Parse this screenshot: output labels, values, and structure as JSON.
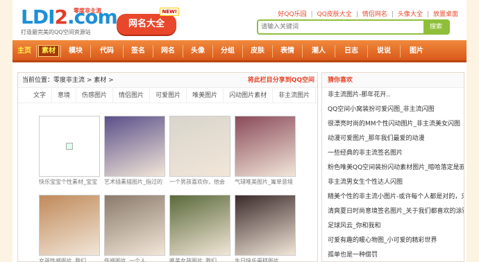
{
  "logo": {
    "text_a": "LDI",
    "text_b": "2",
    "text_c": ".com",
    "slogan": "零度非主流",
    "subtitle": "打造最完美的QQ空间资源站"
  },
  "badge": {
    "label": "网名大全",
    "new": "NEW!"
  },
  "toplinks": [
    "好QQ乐园",
    "QQ皮肤大全",
    "情侣网名",
    "头像大全",
    "放置桌面"
  ],
  "search": {
    "placeholder": "请输入关键词",
    "button": "搜索"
  },
  "nav": [
    "主页",
    "素材",
    "模块",
    "代码",
    "签名",
    "网名",
    "头像",
    "分组",
    "皮肤",
    "表情",
    "潮人",
    "日志",
    "说说",
    "图片"
  ],
  "breadcrumb": {
    "text": "当前位置：零度非主流 > 素材 >",
    "share": "将此栏目分享到QQ空间"
  },
  "tabs": [
    "文字",
    "意境",
    "伤感图片",
    "情侣图片",
    "可爱图片",
    "唯美图片",
    "闪动图片素材",
    "非主流图片"
  ],
  "thumbs": [
    {
      "caption": "快乐宝宝个性素材_宝宝",
      "tone": "#eeeeee"
    },
    {
      "caption": "艺术插素描图片_指过的",
      "tone": "#5a4f8a"
    },
    {
      "caption": "一个男孩喜欢你，他会",
      "tone": "#d8d5cc"
    },
    {
      "caption": "气球唯美图片_寓单意境",
      "tone": "#8a4a5a"
    },
    {
      "caption": "女孩性感图片_我们",
      "tone": "#c08a5a"
    },
    {
      "caption": "伤感图片_一个人",
      "tone": "#8a7a6a"
    },
    {
      "caption": "唯美女孩图片_我们",
      "tone": "#5a6a3a"
    },
    {
      "caption": "生日快乐蛋糕图片",
      "tone": "#3a2a2a"
    }
  ],
  "sidebar": {
    "title": "猜你喜欢",
    "items": [
      "非主流图片-那年花开..",
      "QQ空间小窝装扮可爱闪图_非主流闪图",
      "很漂亮时尚的MM个性闪动图片_非主流美女闪图",
      "动漫可爱图片_那年我们最爱的动漫",
      "一些经典的非主流签名图片",
      "粉色唯美QQ空间装扮闪动素材图片_暗哈落定是寂寞",
      "非主流男女生个性达人闪图",
      "精美个性的非主流小图片-或许每个人都是对的，只有",
      "清爽夏日时尚意境签名图片_关于我们都喜欢的涂鸦不许",
      "足球风云_你和我和",
      "可爱有趣的暖心物图_小可爱的精彩世界",
      "孤单也是一种偿罚"
    ]
  }
}
